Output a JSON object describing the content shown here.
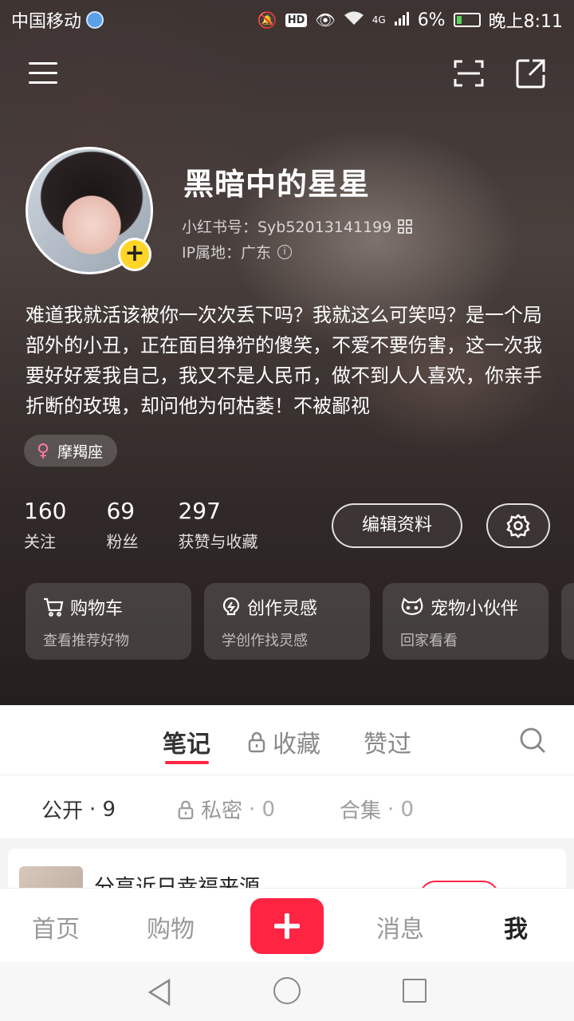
{
  "status_bar": {
    "carrier": "中国移动",
    "hd": "HD",
    "network": "4G",
    "battery": "6%",
    "time": "晚上8:11"
  },
  "profile": {
    "nickname": "黑暗中的星星",
    "red_id": "小红书号：Syb52013141199",
    "ip_location": "IP属地：广东",
    "bio": "难道我就活该被你一次次丢下吗？我就这么可笑吗？是一个局部外的小丑，正在面目狰狞的傻笑，不爱不要伤害，这一次我要好好爱我自己，我又不是人民币，做不到人人喜欢，你亲手折断的玫瑰，却问他为何枯萎！不被鄙视",
    "tag": "摩羯座"
  },
  "stats": {
    "following": {
      "value": "160",
      "label": "关注"
    },
    "followers": {
      "value": "69",
      "label": "粉丝"
    },
    "likes": {
      "value": "297",
      "label": "获赞与收藏"
    }
  },
  "buttons": {
    "edit_profile": "编辑资料"
  },
  "cards": [
    {
      "title": "购物车",
      "subtitle": "查看推荐好物",
      "icon": "cart-icon"
    },
    {
      "title": "创作灵感",
      "subtitle": "学创作找灵感",
      "icon": "bulb-icon"
    },
    {
      "title": "宠物小伙伴",
      "subtitle": "回家看看",
      "icon": "cat-icon"
    }
  ],
  "tabs": {
    "notes": "笔记",
    "collections": "收藏",
    "liked": "赞过"
  },
  "subtabs": {
    "public": {
      "label": "公开",
      "count": "· 9"
    },
    "private": {
      "label": "私密",
      "count": "· 0"
    },
    "albums": {
      "label": "合集",
      "count": "· 0"
    }
  },
  "feed": {
    "first_title": "分享近日幸福来源"
  },
  "bottom_nav": {
    "home": "首页",
    "shop": "购物",
    "messages": "消息",
    "me": "我"
  },
  "colors": {
    "accent": "#ff2442",
    "badge": "#ffd527"
  }
}
